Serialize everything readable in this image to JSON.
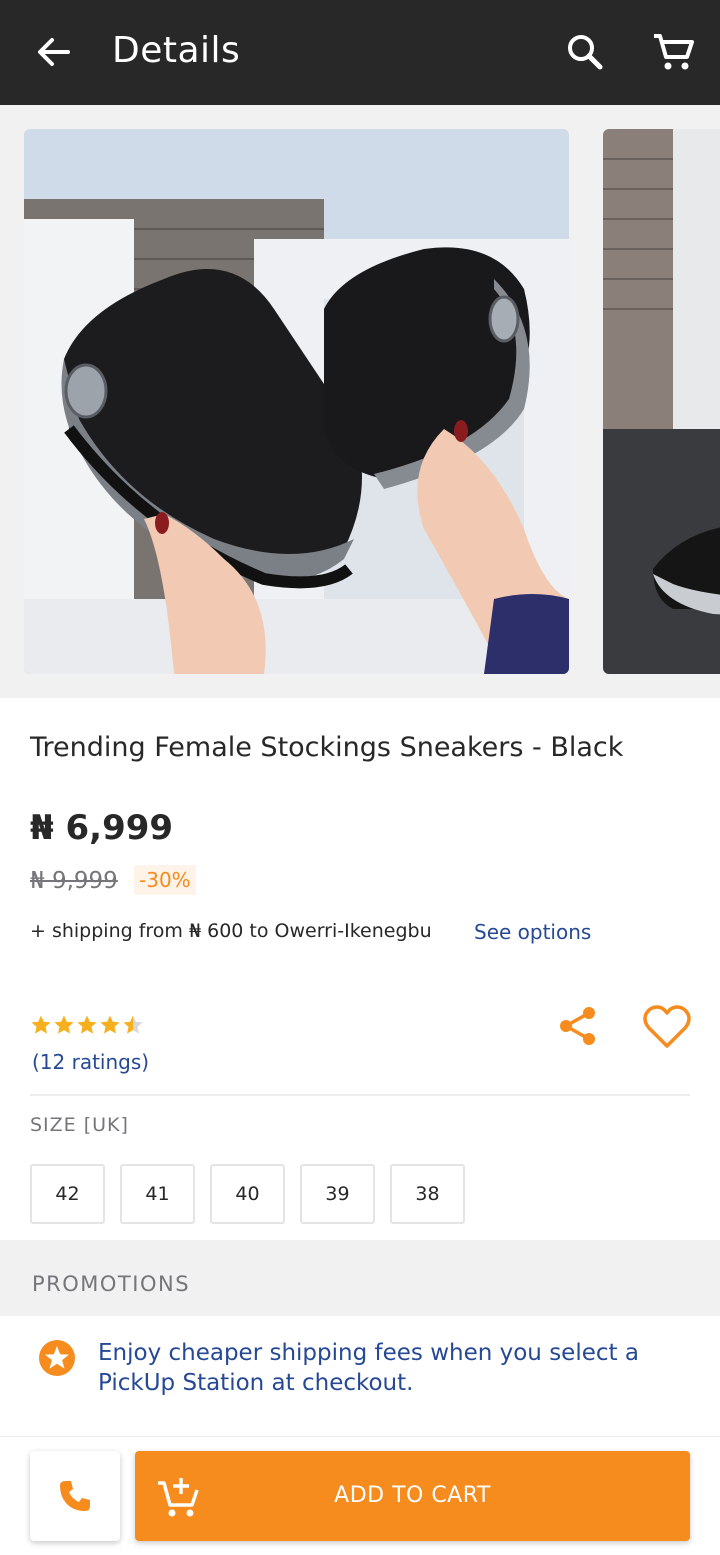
{
  "header": {
    "title": "Details",
    "back_icon": "arrow-left-icon",
    "search_icon": "search-icon",
    "cart_icon": "cart-icon"
  },
  "gallery": {
    "images": [
      {
        "description_icon": "product-photo-sneakers"
      },
      {
        "description_icon": "product-photo-sneakers-partial"
      }
    ]
  },
  "product": {
    "title": "Trending Female Stockings Sneakers - Black",
    "price": "₦ 6,999",
    "old_price": "₦ 9,999",
    "discount": "-30%",
    "shipping_text": "+ shipping from ₦ 600 to Owerri-Ikenegbu",
    "see_options": "See options",
    "rating_value": 4.5,
    "rating_max": 5,
    "ratings_count": "(12 ratings)",
    "size_label": "SIZE [UK]",
    "sizes": [
      "42",
      "41",
      "40",
      "39",
      "38"
    ]
  },
  "promotions": {
    "heading": "PROMOTIONS",
    "items": [
      {
        "icon": "star-badge-icon",
        "text": "Enjoy cheaper shipping fees when you select a PickUp Station at checkout."
      }
    ]
  },
  "actions": {
    "call_icon": "phone-icon",
    "add_to_cart_label": "ADD TO CART",
    "add_to_cart_icon": "cart-add-icon"
  },
  "colors": {
    "header_bg": "#282828",
    "accent": "#f68b1e",
    "link": "#264996",
    "star": "#f6b01e",
    "muted": "#75757a"
  }
}
